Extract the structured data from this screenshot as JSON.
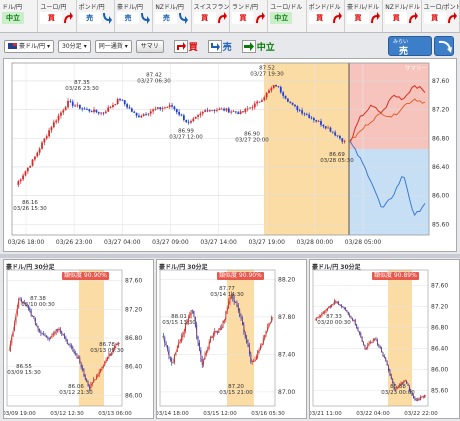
{
  "strip": [
    {
      "pair": "ドル/円",
      "signal": "中立",
      "kind": "neu"
    },
    {
      "pair": "ユーロ/円",
      "signal": "買",
      "kind": "buy"
    },
    {
      "pair": "ポンド/円",
      "signal": "売",
      "kind": "sell"
    },
    {
      "pair": "豪ドル/円",
      "signal": "売",
      "kind": "sell"
    },
    {
      "pair": "NZドル/円",
      "signal": "売",
      "kind": "sell"
    },
    {
      "pair": "スイスフラン/円",
      "signal": "買",
      "kind": "buy"
    },
    {
      "pair": "ランド/円",
      "signal": "買",
      "kind": "buy"
    },
    {
      "pair": "ユーロ/ドル",
      "signal": "中立",
      "kind": "neu"
    },
    {
      "pair": "ポンド/ドル",
      "signal": "買",
      "kind": "buy"
    },
    {
      "pair": "豪ドル/ドル",
      "signal": "買",
      "kind": "buy"
    },
    {
      "pair": "NZドル/ドル",
      "signal": "買",
      "kind": "buy"
    },
    {
      "pair": "ユーロ/ポンド",
      "signal": "買",
      "kind": "buy"
    }
  ],
  "toolbar": {
    "pair_select": "豪ドル/円",
    "interval_select": "30分足",
    "pattern_select": "同一通貨",
    "summary_button": "サマリ",
    "buy_label": "買",
    "sell_label": "売",
    "neutral_label": "中立",
    "mirai_top": "みらい",
    "mirai_signal": "売"
  },
  "main": {
    "forecast_tag": "サマリー",
    "y_ticks": [
      "87.60",
      "87.20",
      "86.80",
      "86.40",
      "86.00",
      "85.60"
    ],
    "x_ticks": [
      "03/26 18:00",
      "03/26 23:00",
      "03/27 04:00",
      "03/27 09:00",
      "03/27 14:00",
      "03/27 19:00",
      "03/28 00:00",
      "03/28 05:00"
    ],
    "annotations": [
      {
        "price": "86.16",
        "time": "03/26 15:30"
      },
      {
        "price": "87.35",
        "time": "03/26 23:30"
      },
      {
        "price": "87.42",
        "time": "03/27 06:30"
      },
      {
        "price": "86.99",
        "time": "03/27 12:00"
      },
      {
        "price": "87.52",
        "time": "03/27 19:30"
      },
      {
        "price": "86.90",
        "time": "03/27 20:00"
      },
      {
        "price": "86.69",
        "time": "03/28 05:30"
      }
    ]
  },
  "minis": [
    {
      "title": "豪ドル/円 30分足",
      "badge": "類似度 90.90%",
      "y_ticks": [
        "87.60",
        "87.20",
        "86.80",
        "86.40",
        "86.00"
      ],
      "x_ticks": [
        "03/09 19:00",
        "03/12 12:30",
        "03/13 06:00"
      ],
      "annotations": [
        {
          "price": "87.38",
          "time": "03/10 00:30"
        },
        {
          "price": "86.55",
          "time": "03/09 15:30"
        },
        {
          "price": "86.78",
          "time": "03/13 09:30"
        },
        {
          "price": "86.06",
          "time": "03/12 21:30"
        }
      ]
    },
    {
      "title": "豪ドル/円 30分足",
      "badge": "類似度 90.90%",
      "y_ticks": [
        "88.20",
        "87.80",
        "87.40",
        "87.00"
      ],
      "x_ticks": [
        "03/14 18:00",
        "03/15 12:00",
        "03/16 05:30"
      ],
      "annotations": [
        {
          "price": "88.01",
          "time": "03/15 13:30"
        },
        {
          "price": "87.77",
          "time": "03/14 14:30"
        },
        {
          "price": "87.20",
          "time": "03/15 21:00"
        }
      ]
    },
    {
      "title": "豪ドル/円 30分足",
      "badge": "類似度 90.89%",
      "y_ticks": [
        "87.60",
        "87.20",
        "86.80",
        "86.40",
        "86.00",
        "85.60"
      ],
      "x_ticks": [
        "03/21 11:00",
        "03/22 04:00",
        "03/22 22:00"
      ],
      "annotations": [
        {
          "price": "87.33",
          "time": "03/20 00:30"
        },
        {
          "price": "85.38",
          "time": "03/23 00:00"
        }
      ]
    }
  ],
  "colors": {
    "up": "#d52b2b",
    "down": "#1f3fd2",
    "highlight": "#fbdca4",
    "forecastRed": "#f6c3bd",
    "forecastBlue": "#c7dff5"
  }
}
